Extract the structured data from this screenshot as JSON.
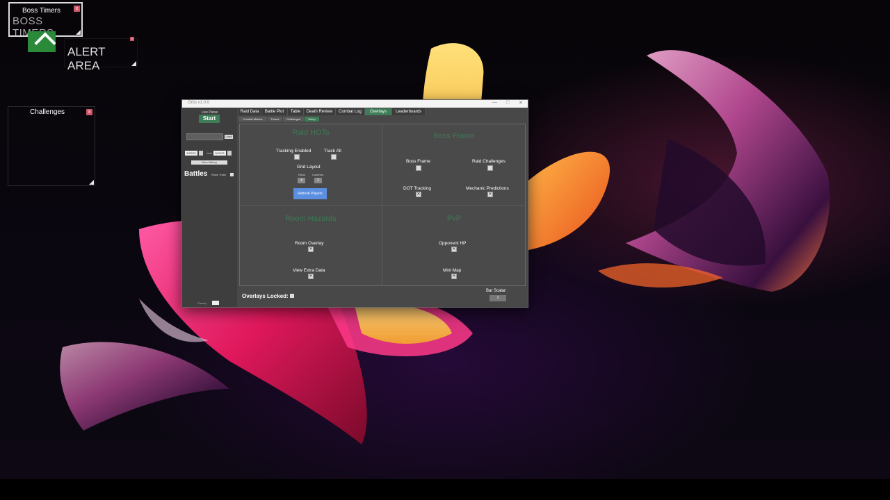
{
  "overlays": {
    "boss_timers_title": "Boss Timers",
    "boss_timers_big": "BOSS TIMERS",
    "alert_area": "ALERT AREA",
    "challenges_title": "Challenges",
    "close_glyph": "x"
  },
  "window": {
    "title": "Orbs v1.0.0",
    "minimize": "—",
    "maximize": "□",
    "close": "✕"
  },
  "sidebar": {
    "live_parse_label": "Live Parse",
    "start_button": "Start",
    "load_button": "Load",
    "date_from": "5/22/23",
    "date_to": "5/23/23",
    "view_history": "View History",
    "battles_heading": "Battles",
    "show_trash": "Show Trash",
    "parsely_label": "Parsely"
  },
  "tabs": [
    "Raid Data",
    "Battle Plot",
    "Table",
    "Death Review",
    "Combat Log",
    "Overlays",
    "Leaderboards"
  ],
  "active_tab": "Overlays",
  "subtabs": [
    "Combat Metrics",
    "Timers",
    "Challenges",
    "Setup"
  ],
  "active_subtab": "Setup",
  "sections": {
    "raid_hots": {
      "title": "Raid HOTs",
      "tracking_enabled": "Tracking Enabled",
      "track_all": "Track All",
      "grid_layout": "Grid Layout",
      "rows_label": "Rows",
      "rows_value": "4",
      "columns_label": "Columns",
      "columns_value": "2",
      "refresh_button": "Refresh Players"
    },
    "boss_frame": {
      "title": "Boss Frame",
      "boss_frame": "Boss Frame",
      "raid_challenges": "Raid Challenges",
      "dot_tracking": "DOT Tracking",
      "mechanic_predictions": "Mechanic Predictions"
    },
    "room_hazards": {
      "title": "Room Hazards",
      "room_overlay": "Room Overlay",
      "view_extra_data": "View Extra Data"
    },
    "pvp": {
      "title": "PvP",
      "opponent_hp": "Opponent HP",
      "mini_map": "Mini Map"
    }
  },
  "checked_glyph": "✕",
  "footer": {
    "overlays_locked": "Overlays Locked:",
    "bar_scalar": "Bar Scalar:",
    "bar_scalar_value": "1"
  },
  "colors": {
    "accent_green": "#3e7d58",
    "refresh_blue": "#5b8fe0",
    "window_bg": "#484848"
  }
}
